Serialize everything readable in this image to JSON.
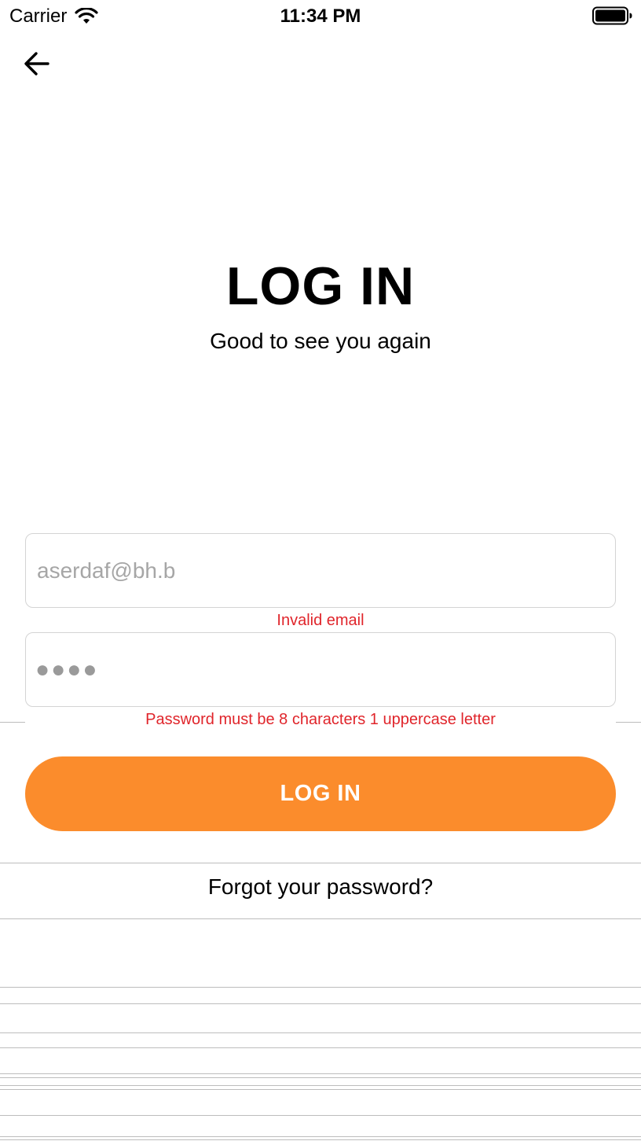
{
  "status_bar": {
    "carrier": "Carrier",
    "time": "11:34 PM"
  },
  "icons": {
    "back": "arrow-left-icon",
    "wifi": "wifi-icon",
    "battery": "battery-icon"
  },
  "header": {
    "title": "LOG IN",
    "subtitle": "Good to see you again"
  },
  "form": {
    "email_value": "aserdaf@bh.b",
    "email_error": "Invalid email",
    "password_masked": "●●●●",
    "password_error": "Password must be 8 characters 1 uppercase letter",
    "login_label": "LOG IN",
    "forgot_label": "Forgot your password?"
  },
  "colors": {
    "accent": "#fb8c2c",
    "error": "#e0252b",
    "placeholder_text": "#a6a6a6"
  }
}
